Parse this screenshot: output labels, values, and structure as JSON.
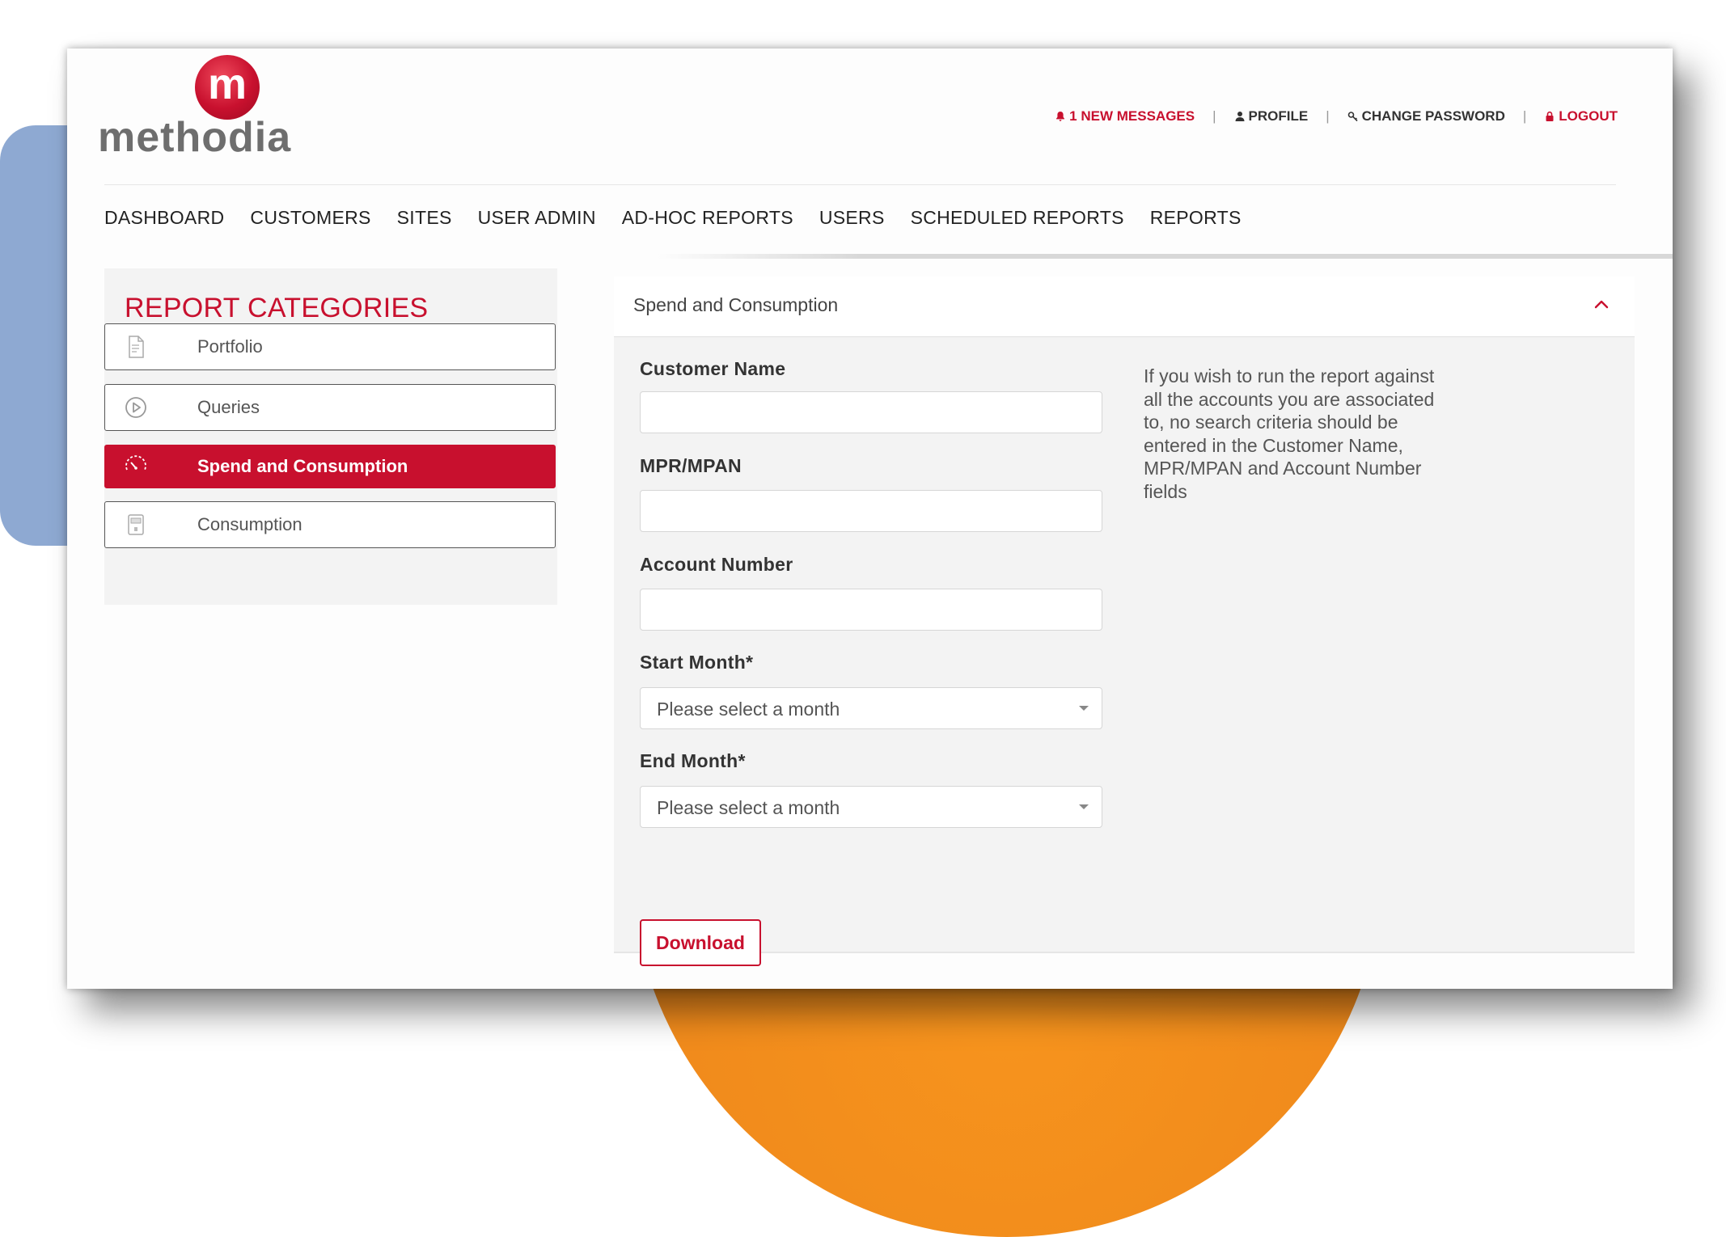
{
  "brand": {
    "logo_letter": "m",
    "logo_text": "methodia"
  },
  "topbar": {
    "messages": "1 NEW MESSAGES",
    "profile": "PROFILE",
    "change_password": "CHANGE PASSWORD",
    "logout": "LOGOUT",
    "separator": "|"
  },
  "nav": {
    "items": [
      {
        "label": "DASHBOARD"
      },
      {
        "label": "CUSTOMERS"
      },
      {
        "label": "SITES"
      },
      {
        "label": "USER ADMIN"
      },
      {
        "label": "AD-HOC REPORTS"
      },
      {
        "label": "USERS"
      },
      {
        "label": "SCHEDULED REPORTS"
      },
      {
        "label": "REPORTS"
      }
    ]
  },
  "sidebar": {
    "title": "REPORT CATEGORIES",
    "items": [
      {
        "label": "Portfolio",
        "icon": "document-icon",
        "active": false
      },
      {
        "label": "Queries",
        "icon": "play-circle-icon",
        "active": false
      },
      {
        "label": "Spend and Consumption",
        "icon": "gauge-icon",
        "active": true
      },
      {
        "label": "Consumption",
        "icon": "meter-icon",
        "active": false
      }
    ]
  },
  "panel": {
    "title": "Spend and Consumption",
    "fields": {
      "customer_name": {
        "label": "Customer Name",
        "value": ""
      },
      "mpr_mpan": {
        "label": "MPR/MPAN",
        "value": ""
      },
      "account_number": {
        "label": "Account Number",
        "value": ""
      },
      "start_month": {
        "label": "Start Month*",
        "selected": "Please select a month"
      },
      "end_month": {
        "label": "End Month*",
        "selected": "Please select a month"
      }
    },
    "download_label": "Download",
    "help_text": "If you wish to run the report against all the accounts you are associated to, no search criteria should be entered in the Customer Name, MPR/MPAN and Account Number fields"
  },
  "colors": {
    "brand_red": "#c8102e",
    "text_dark": "#333333",
    "panel_bg": "#f3f3f3"
  }
}
